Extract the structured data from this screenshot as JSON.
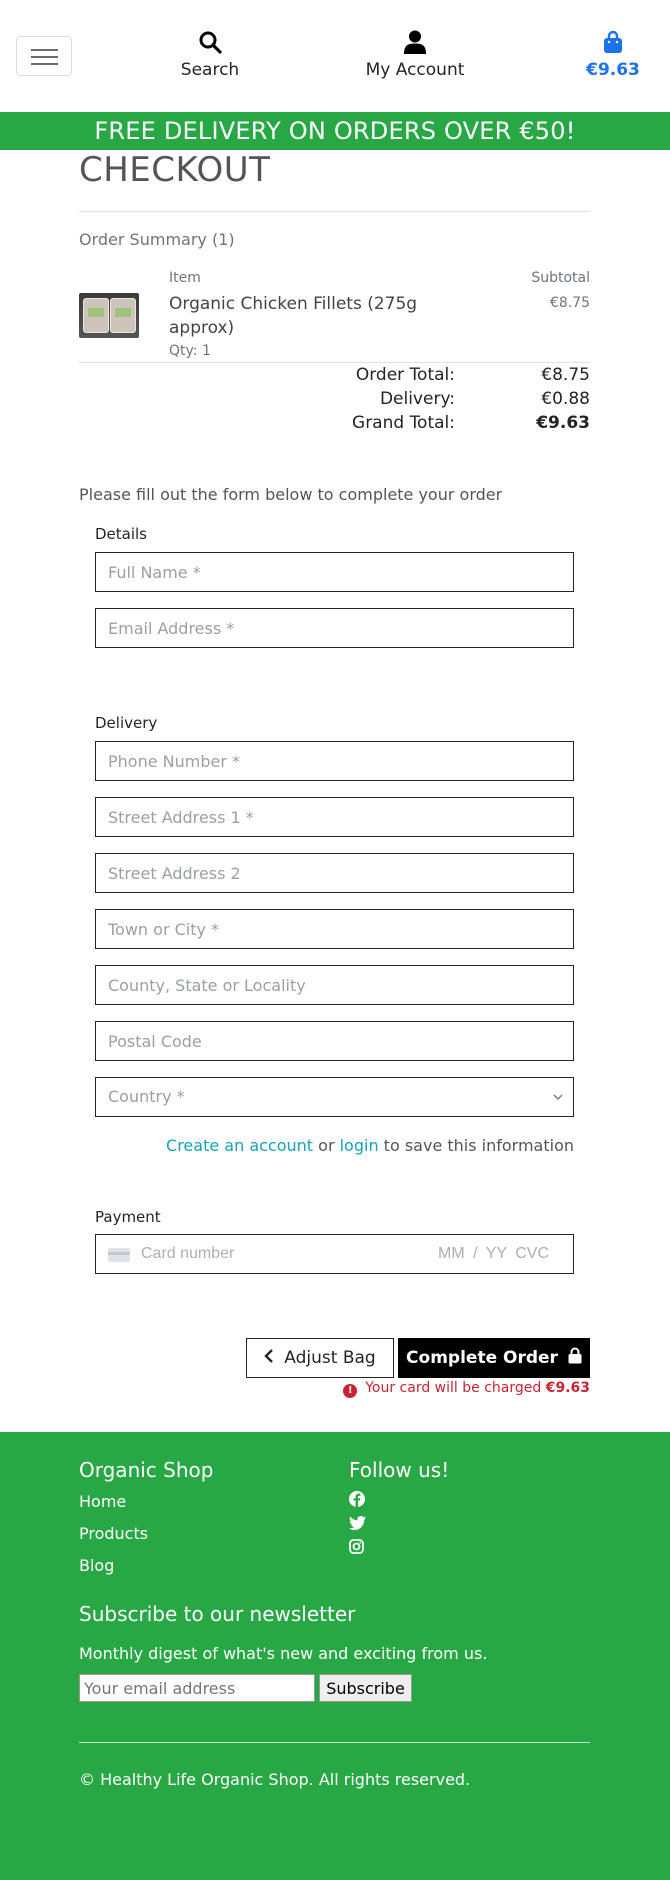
{
  "header": {
    "search_label": "Search",
    "account_label": "My Account",
    "bag_total": "€9.63",
    "icons": {
      "menu": "hamburger-icon",
      "search": "search-icon",
      "account": "user-icon",
      "bag": "shopping-bag-icon"
    },
    "bag_color": "#1a73e8"
  },
  "banner": {
    "text": "FREE DELIVERY ON ORDERS OVER €50!",
    "color": "#28a745"
  },
  "checkout": {
    "title": "CHECKOUT",
    "summary_heading": "Order Summary (1)",
    "columns": {
      "item": "Item",
      "subtotal": "Subtotal"
    },
    "items": [
      {
        "name": "Organic Chicken Fillets (275g approx)",
        "qty": "Qty: 1",
        "price": "€8.75"
      }
    ],
    "totals": {
      "order_total_label": "Order Total:",
      "order_total": "€8.75",
      "delivery_label": "Delivery:",
      "delivery": "€0.88",
      "grand_total_label": "Grand Total:",
      "grand_total": "€9.63"
    },
    "instructions": "Please fill out the form below to complete your order"
  },
  "form": {
    "details_label": "Details",
    "full_name_placeholder": "Full Name *",
    "email_placeholder": "Email Address *",
    "delivery_label": "Delivery",
    "phone_placeholder": "Phone Number *",
    "street1_placeholder": "Street Address 1 *",
    "street2_placeholder": "Street Address 2",
    "town_placeholder": "Town or City *",
    "county_placeholder": "County, State or Locality",
    "postcode_placeholder": "Postal Code",
    "country_placeholder": "Country *",
    "create_account_link": "Create an account",
    "or_text": " or ",
    "login_link": "login",
    "save_info_suffix": " to save this information",
    "payment_label": "Payment",
    "card_number_placeholder": "Card number",
    "card_exp_cvc_placeholder": "MM / YY  CVC"
  },
  "actions": {
    "adjust_bag": "Adjust Bag",
    "complete_order": "Complete Order",
    "charge_text": "Your card will be charged ",
    "charge_amount": "€9.63",
    "warning_color": "#c82333"
  },
  "footer": {
    "shop_heading": "Organic Shop",
    "links": [
      "Home",
      "Products",
      "Blog"
    ],
    "follow_heading": "Follow us!",
    "social_icons": [
      "facebook-icon",
      "twitter-icon",
      "instagram-icon"
    ],
    "newsletter_heading": "Subscribe to our newsletter",
    "newsletter_desc": "Monthly digest of what's new and exciting from us.",
    "email_placeholder": "Your email address",
    "subscribe_label": "Subscribe",
    "copyright": "© Healthy Life Organic Shop. All rights reserved."
  }
}
